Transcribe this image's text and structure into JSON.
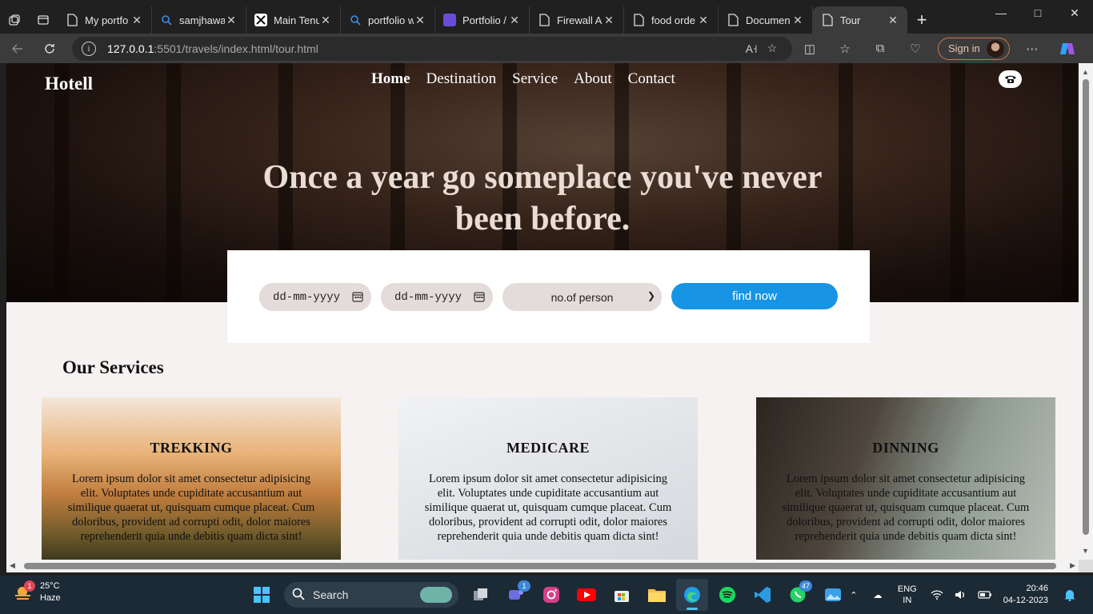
{
  "browser": {
    "tabs": [
      {
        "label": "My portfo",
        "icon": "page-icon"
      },
      {
        "label": "samjhawa",
        "icon": "search-icon"
      },
      {
        "label": "Main Tenu",
        "icon": "music-app-icon"
      },
      {
        "label": "portfolio w",
        "icon": "search-icon"
      },
      {
        "label": "Portfolio /",
        "icon": "colorlib-icon"
      },
      {
        "label": "Firewall A",
        "icon": "page-icon"
      },
      {
        "label": "food orde",
        "icon": "page-icon"
      },
      {
        "label": "Documen",
        "icon": "page-icon"
      },
      {
        "label": "Tour",
        "icon": "page-icon",
        "active": true
      }
    ],
    "url_host": "127.0.0.1",
    "url_path": ":5501/travels/index.html/tour.html",
    "signin_label": "Sign in"
  },
  "page": {
    "brand": "Hotell",
    "nav": [
      "Home",
      "Destination",
      "Service",
      "About",
      "Contact"
    ],
    "hero_title": "Once a year go someplace you've never been before.",
    "booking": {
      "checkin_placeholder": "dd-mm-yyyy",
      "checkout_placeholder": "dd-mm-yyyy",
      "persons_value": "no.of person",
      "find_button": "find now"
    },
    "services_title": "Our Services",
    "services": [
      {
        "title": "TREKKING",
        "text": "Lorem ipsum dolor sit amet consectetur adipisicing elit. Voluptates unde cupiditate accusantium aut similique quaerat ut, quisquam cumque placeat. Cum doloribus, provident ad corrupti odit, dolor maiores reprehenderit quia unde debitis quam dicta sint!"
      },
      {
        "title": "MEDICARE",
        "text": "Lorem ipsum dolor sit amet consectetur adipisicing elit. Voluptates unde cupiditate accusantium aut similique quaerat ut, quisquam cumque placeat. Cum doloribus, provident ad corrupti odit, dolor maiores reprehenderit quia unde debitis quam dicta sint!"
      },
      {
        "title": "DINNING",
        "text": "Lorem ipsum dolor sit amet consectetur adipisicing elit. Voluptates unde cupiditate accusantium aut similique quaerat ut, quisquam cumque placeat. Cum doloribus, provident ad corrupti odit, dolor maiores reprehenderit quia unde debitis quam dicta sint!"
      }
    ]
  },
  "taskbar": {
    "weather_temp": "25°C",
    "weather_cond": "Haze",
    "weather_badge": "1",
    "search_label": "Search",
    "teams_badge": "1",
    "whatsapp_badge": "47",
    "lang_line1": "ENG",
    "lang_line2": "IN",
    "time": "20:46",
    "date": "04-12-2023"
  },
  "colors": {
    "accent_button": "#1794e4",
    "field_bg": "#e3dcda",
    "page_bg": "#f5f2f1"
  }
}
